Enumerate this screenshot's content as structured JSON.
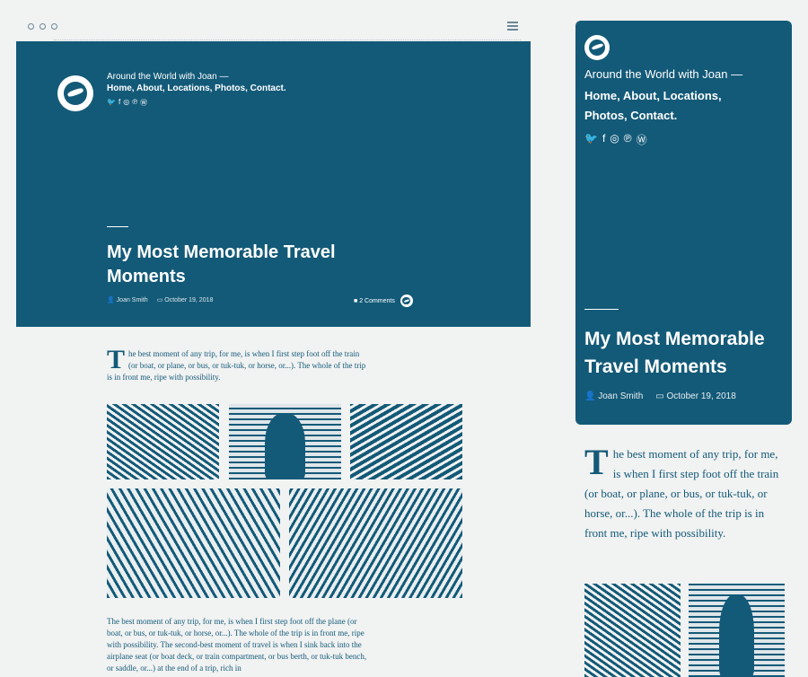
{
  "site": {
    "name": "Around the World with Joan —",
    "nav": "Home, About, Locations, Photos, Contact.",
    "social_icons": [
      "twitter-icon",
      "facebook-icon",
      "instagram-icon",
      "pinterest-icon",
      "wordpress-icon"
    ]
  },
  "post": {
    "title": "My Most Memorable Travel Moments",
    "author": "Joan Smith",
    "date": "October 19, 2018",
    "comments": "2 Comments",
    "drop_cap": "T",
    "intro": "he best moment of any trip, for me, is when I first step foot off the train (or boat, or plane, or bus, or tuk-tuk, or horse, or...). The whole of the trip is in front me, ripe with possibility.",
    "body2": "The best moment of any trip, for me, is when I first step foot off the plane (or boat, or bus, or tuk-tuk, or horse, or...). The whole of the trip is in front me, ripe with possibility. The second-best moment of travel is when I sink back into the airplane seat (or boat deck, or train compartment, or bus berth, or tuk-tuk bench, or saddle, or...) at the end of a trip, rich in"
  },
  "colors": {
    "accent": "#135a78",
    "background": "#f1f2f2",
    "text_on_accent": "#ffffff"
  }
}
